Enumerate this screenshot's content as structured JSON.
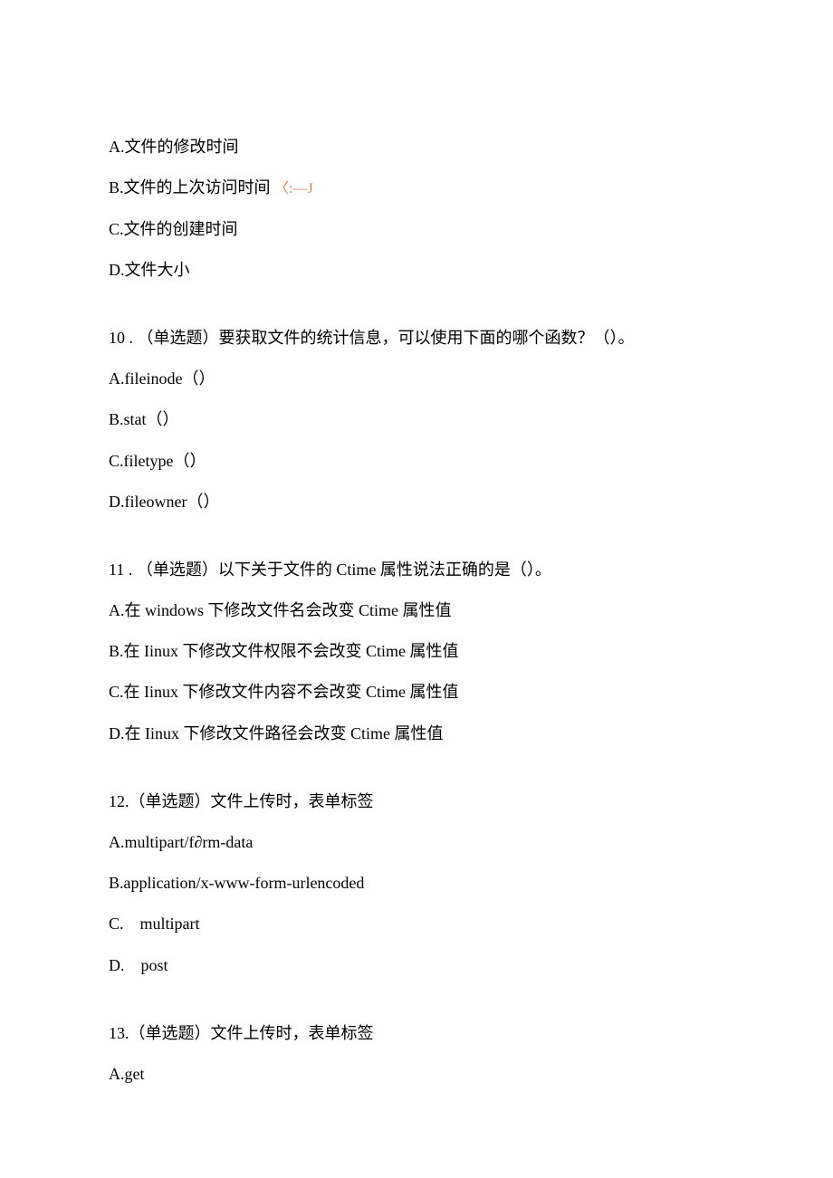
{
  "q9": {
    "optA": "A.文件的修改时间",
    "optB_prefix": "B.文件的上次访问时间 ",
    "optB_annot": "〈:—J",
    "optC": "C.文件的创建时间",
    "optD": "D.文件大小"
  },
  "q10": {
    "stem": "10  . （单选题）要获取文件的统计信息，可以使用下面的哪个函数？（）。",
    "optA": "A.fileinode（）",
    "optB": "B.stat（）",
    "optC": "C.filetype（）",
    "optD": "D.fileowner（）"
  },
  "q11": {
    "stem": "11  . （单选题）以下关于文件的 Ctime 属性说法正确的是（）。",
    "optA": "A.在 windows 下修改文件名会改变 Ctime 属性值",
    "optB": "B.在 Iinux 下修改文件权限不会改变 Ctime 属性值",
    "optC": "C.在 Iinux 下修改文件内容不会改变 Ctime 属性值",
    "optD": "D.在 Iinux 下修改文件路径会改变 Ctime 属性值"
  },
  "q12": {
    "stem": "12.（单选题）文件上传时，表单标签",
    "optA": "A.multipart/f∂rm-data",
    "optB": "B.application/x-www-form-urlencoded",
    "optC": "C.　multipart",
    "optD": "D.　post"
  },
  "q13": {
    "stem": "13.（单选题）文件上传时，表单标签",
    "optA": "A.get"
  }
}
